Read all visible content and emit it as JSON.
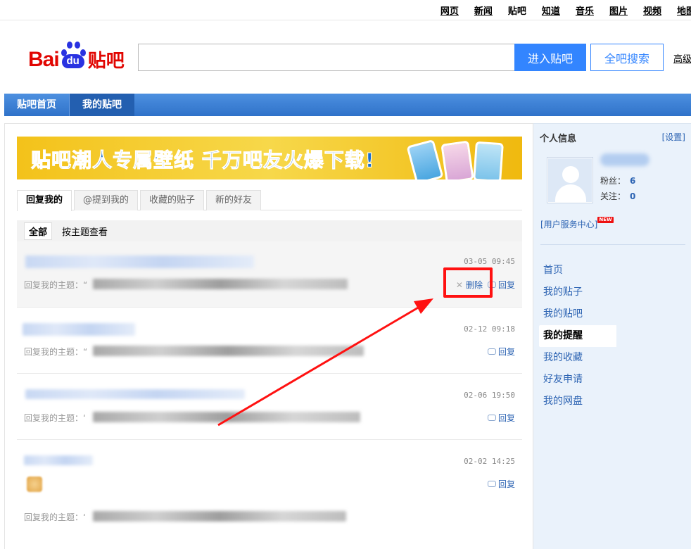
{
  "topnav": [
    "网页",
    "新闻",
    "贴吧",
    "知道",
    "音乐",
    "图片",
    "视频",
    "地图"
  ],
  "topnav_current": "贴吧",
  "logo": {
    "bai": "Bai",
    "du": "du",
    "tieba": "贴吧"
  },
  "search": {
    "value": "",
    "enter_label": "进入贴吧",
    "all_label": "全吧搜索",
    "advanced_label": "高级"
  },
  "bluebar": {
    "home": "贴吧首页",
    "mine": "我的贴吧"
  },
  "banner": {
    "text": "贴吧潮人专属壁纸 千万吧友火爆下载!"
  },
  "tabs": [
    "回复我的",
    "@提到我的",
    "收藏的贴子",
    "新的好友"
  ],
  "filters": [
    "全部",
    "按主题查看"
  ],
  "items": [
    {
      "time": "03-05 09:45",
      "topic_label": "回复我的主题：“",
      "delete_label": "删除",
      "reply_label": "回复"
    },
    {
      "time": "02-12 09:18",
      "topic_label": "回复我的主题：“",
      "reply_label": "回复"
    },
    {
      "time": "02-06 19:50",
      "topic_label": "回复我的主题：‘",
      "reply_label": "回复"
    },
    {
      "time": "02-02 14:25",
      "topic_label": "回复我的主题：‘",
      "reply_label": "回复"
    }
  ],
  "sidebar": {
    "header": "个人信息",
    "settings": "[设置]",
    "fans_label": "粉丝：",
    "fans": "6",
    "follow_label": "关注：",
    "follow": "0",
    "service": "[用户服务中心]",
    "new_badge": "NEW",
    "menu": [
      "首页",
      "我的贴子",
      "我的贴吧",
      "我的提醒",
      "我的收藏",
      "好友申请",
      "我的网盘"
    ],
    "menu_active": "我的提醒"
  },
  "colors": {
    "accent": "#3385ff",
    "bar": "#3a7fd5",
    "link": "#2d64b3",
    "annotation": "#ff1111"
  }
}
